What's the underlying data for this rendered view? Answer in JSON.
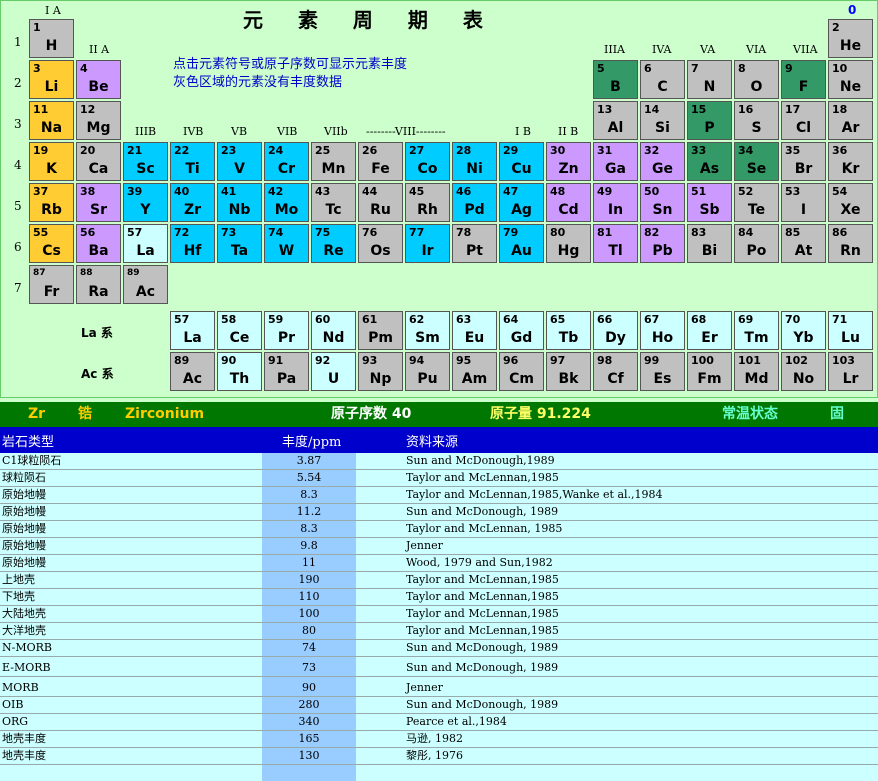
{
  "title": "元 素 周 期 表",
  "instructions": [
    "点击元素符号或原子序数可显示元素丰度",
    "灰色区域的元素没有丰度数据"
  ],
  "group_labels": [
    "I A",
    "II A",
    "IIIB",
    "IVB",
    "VB",
    "VIB",
    "VIIb",
    "--------VIII--------",
    "I B",
    "II B",
    "IIIA",
    "IVA",
    "VA",
    "VIA",
    "VIIA",
    "0"
  ],
  "period_labels": [
    "1",
    "2",
    "3",
    "4",
    "5",
    "6",
    "7"
  ],
  "series_labels": [
    "La 系",
    "Ac 系"
  ],
  "colors": {
    "alkali": "#ffcc33",
    "pblock_purple": "#cc99ff",
    "transition": "#00ccff",
    "green": "#339966",
    "gray": "#c0c0c0",
    "lanthanide": "#ccffff"
  },
  "elements": [
    {
      "n": "1",
      "s": "H",
      "r": 0,
      "c": 0,
      "t": "gray"
    },
    {
      "n": "2",
      "s": "He",
      "r": 0,
      "c": 17,
      "t": "gray"
    },
    {
      "n": "3",
      "s": "Li",
      "r": 1,
      "c": 0,
      "t": "alkali"
    },
    {
      "n": "4",
      "s": "Be",
      "r": 1,
      "c": 1,
      "t": "pblock_purple"
    },
    {
      "n": "5",
      "s": "B",
      "r": 1,
      "c": 12,
      "t": "green"
    },
    {
      "n": "6",
      "s": "C",
      "r": 1,
      "c": 13,
      "t": "gray"
    },
    {
      "n": "7",
      "s": "N",
      "r": 1,
      "c": 14,
      "t": "gray"
    },
    {
      "n": "8",
      "s": "O",
      "r": 1,
      "c": 15,
      "t": "gray"
    },
    {
      "n": "9",
      "s": "F",
      "r": 1,
      "c": 16,
      "t": "green"
    },
    {
      "n": "10",
      "s": "Ne",
      "r": 1,
      "c": 17,
      "t": "gray"
    },
    {
      "n": "11",
      "s": "Na",
      "r": 2,
      "c": 0,
      "t": "alkali"
    },
    {
      "n": "12",
      "s": "Mg",
      "r": 2,
      "c": 1,
      "t": "gray"
    },
    {
      "n": "13",
      "s": "Al",
      "r": 2,
      "c": 12,
      "t": "gray"
    },
    {
      "n": "14",
      "s": "Si",
      "r": 2,
      "c": 13,
      "t": "gray"
    },
    {
      "n": "15",
      "s": "P",
      "r": 2,
      "c": 14,
      "t": "green"
    },
    {
      "n": "16",
      "s": "S",
      "r": 2,
      "c": 15,
      "t": "gray"
    },
    {
      "n": "17",
      "s": "Cl",
      "r": 2,
      "c": 16,
      "t": "gray"
    },
    {
      "n": "18",
      "s": "Ar",
      "r": 2,
      "c": 17,
      "t": "gray"
    },
    {
      "n": "19",
      "s": "K",
      "r": 3,
      "c": 0,
      "t": "alkali"
    },
    {
      "n": "20",
      "s": "Ca",
      "r": 3,
      "c": 1,
      "t": "gray"
    },
    {
      "n": "21",
      "s": "Sc",
      "r": 3,
      "c": 2,
      "t": "transition"
    },
    {
      "n": "22",
      "s": "Ti",
      "r": 3,
      "c": 3,
      "t": "transition"
    },
    {
      "n": "23",
      "s": "V",
      "r": 3,
      "c": 4,
      "t": "transition"
    },
    {
      "n": "24",
      "s": "Cr",
      "r": 3,
      "c": 5,
      "t": "transition"
    },
    {
      "n": "25",
      "s": "Mn",
      "r": 3,
      "c": 6,
      "t": "gray"
    },
    {
      "n": "26",
      "s": "Fe",
      "r": 3,
      "c": 7,
      "t": "gray"
    },
    {
      "n": "27",
      "s": "Co",
      "r": 3,
      "c": 8,
      "t": "transition"
    },
    {
      "n": "28",
      "s": "Ni",
      "r": 3,
      "c": 9,
      "t": "transition"
    },
    {
      "n": "29",
      "s": "Cu",
      "r": 3,
      "c": 10,
      "t": "transition"
    },
    {
      "n": "30",
      "s": "Zn",
      "r": 3,
      "c": 11,
      "t": "pblock_purple"
    },
    {
      "n": "31",
      "s": "Ga",
      "r": 3,
      "c": 12,
      "t": "pblock_purple"
    },
    {
      "n": "32",
      "s": "Ge",
      "r": 3,
      "c": 13,
      "t": "pblock_purple"
    },
    {
      "n": "33",
      "s": "As",
      "r": 3,
      "c": 14,
      "t": "green"
    },
    {
      "n": "34",
      "s": "Se",
      "r": 3,
      "c": 15,
      "t": "green"
    },
    {
      "n": "35",
      "s": "Br",
      "r": 3,
      "c": 16,
      "t": "gray"
    },
    {
      "n": "36",
      "s": "Kr",
      "r": 3,
      "c": 17,
      "t": "gray"
    },
    {
      "n": "37",
      "s": "Rb",
      "r": 4,
      "c": 0,
      "t": "alkali"
    },
    {
      "n": "38",
      "s": "Sr",
      "r": 4,
      "c": 1,
      "t": "pblock_purple"
    },
    {
      "n": "39",
      "s": "Y",
      "r": 4,
      "c": 2,
      "t": "transition"
    },
    {
      "n": "40",
      "s": "Zr",
      "r": 4,
      "c": 3,
      "t": "transition"
    },
    {
      "n": "41",
      "s": "Nb",
      "r": 4,
      "c": 4,
      "t": "transition"
    },
    {
      "n": "42",
      "s": "Mo",
      "r": 4,
      "c": 5,
      "t": "transition"
    },
    {
      "n": "43",
      "s": "Tc",
      "r": 4,
      "c": 6,
      "t": "gray"
    },
    {
      "n": "44",
      "s": "Ru",
      "r": 4,
      "c": 7,
      "t": "gray"
    },
    {
      "n": "45",
      "s": "Rh",
      "r": 4,
      "c": 8,
      "t": "gray"
    },
    {
      "n": "46",
      "s": "Pd",
      "r": 4,
      "c": 9,
      "t": "transition"
    },
    {
      "n": "47",
      "s": "Ag",
      "r": 4,
      "c": 10,
      "t": "transition"
    },
    {
      "n": "48",
      "s": "Cd",
      "r": 4,
      "c": 11,
      "t": "pblock_purple"
    },
    {
      "n": "49",
      "s": "In",
      "r": 4,
      "c": 12,
      "t": "pblock_purple"
    },
    {
      "n": "50",
      "s": "Sn",
      "r": 4,
      "c": 13,
      "t": "pblock_purple"
    },
    {
      "n": "51",
      "s": "Sb",
      "r": 4,
      "c": 14,
      "t": "pblock_purple"
    },
    {
      "n": "52",
      "s": "Te",
      "r": 4,
      "c": 15,
      "t": "gray"
    },
    {
      "n": "53",
      "s": "I",
      "r": 4,
      "c": 16,
      "t": "gray"
    },
    {
      "n": "54",
      "s": "Xe",
      "r": 4,
      "c": 17,
      "t": "gray"
    },
    {
      "n": "55",
      "s": "Cs",
      "r": 5,
      "c": 0,
      "t": "alkali"
    },
    {
      "n": "56",
      "s": "Ba",
      "r": 5,
      "c": 1,
      "t": "pblock_purple"
    },
    {
      "n": "57",
      "s": "La",
      "r": 5,
      "c": 2,
      "t": "lanthanide"
    },
    {
      "n": "72",
      "s": "Hf",
      "r": 5,
      "c": 3,
      "t": "transition"
    },
    {
      "n": "73",
      "s": "Ta",
      "r": 5,
      "c": 4,
      "t": "transition"
    },
    {
      "n": "74",
      "s": "W",
      "r": 5,
      "c": 5,
      "t": "transition"
    },
    {
      "n": "75",
      "s": "Re",
      "r": 5,
      "c": 6,
      "t": "transition"
    },
    {
      "n": "76",
      "s": "Os",
      "r": 5,
      "c": 7,
      "t": "gray"
    },
    {
      "n": "77",
      "s": "Ir",
      "r": 5,
      "c": 8,
      "t": "transition"
    },
    {
      "n": "78",
      "s": "Pt",
      "r": 5,
      "c": 9,
      "t": "gray"
    },
    {
      "n": "79",
      "s": "Au",
      "r": 5,
      "c": 10,
      "t": "transition"
    },
    {
      "n": "80",
      "s": "Hg",
      "r": 5,
      "c": 11,
      "t": "gray"
    },
    {
      "n": "81",
      "s": "Tl",
      "r": 5,
      "c": 12,
      "t": "pblock_purple"
    },
    {
      "n": "82",
      "s": "Pb",
      "r": 5,
      "c": 13,
      "t": "pblock_purple"
    },
    {
      "n": "83",
      "s": "Bi",
      "r": 5,
      "c": 14,
      "t": "gray"
    },
    {
      "n": "84",
      "s": "Po",
      "r": 5,
      "c": 15,
      "t": "gray"
    },
    {
      "n": "85",
      "s": "At",
      "r": 5,
      "c": 16,
      "t": "gray"
    },
    {
      "n": "86",
      "s": "Rn",
      "r": 5,
      "c": 17,
      "t": "gray"
    },
    {
      "n": "87",
      "s": "Fr",
      "r": 6,
      "c": 0,
      "t": "gray"
    },
    {
      "n": "88",
      "s": "Ra",
      "r": 6,
      "c": 1,
      "t": "gray"
    },
    {
      "n": "89",
      "s": "Ac",
      "r": 6,
      "c": 2,
      "t": "gray"
    },
    {
      "n": "57",
      "s": "La",
      "r": 7,
      "c": 3,
      "t": "lanthanide"
    },
    {
      "n": "58",
      "s": "Ce",
      "r": 7,
      "c": 4,
      "t": "lanthanide"
    },
    {
      "n": "59",
      "s": "Pr",
      "r": 7,
      "c": 5,
      "t": "lanthanide"
    },
    {
      "n": "60",
      "s": "Nd",
      "r": 7,
      "c": 6,
      "t": "lanthanide"
    },
    {
      "n": "61",
      "s": "Pm",
      "r": 7,
      "c": 7,
      "t": "gray"
    },
    {
      "n": "62",
      "s": "Sm",
      "r": 7,
      "c": 8,
      "t": "lanthanide"
    },
    {
      "n": "63",
      "s": "Eu",
      "r": 7,
      "c": 9,
      "t": "lanthanide"
    },
    {
      "n": "64",
      "s": "Gd",
      "r": 7,
      "c": 10,
      "t": "lanthanide"
    },
    {
      "n": "65",
      "s": "Tb",
      "r": 7,
      "c": 11,
      "t": "lanthanide"
    },
    {
      "n": "66",
      "s": "Dy",
      "r": 7,
      "c": 12,
      "t": "lanthanide"
    },
    {
      "n": "67",
      "s": "Ho",
      "r": 7,
      "c": 13,
      "t": "lanthanide"
    },
    {
      "n": "68",
      "s": "Er",
      "r": 7,
      "c": 14,
      "t": "lanthanide"
    },
    {
      "n": "69",
      "s": "Tm",
      "r": 7,
      "c": 15,
      "t": "lanthanide"
    },
    {
      "n": "70",
      "s": "Yb",
      "r": 7,
      "c": 16,
      "t": "lanthanide"
    },
    {
      "n": "71",
      "s": "Lu",
      "r": 7,
      "c": 17,
      "t": "lanthanide"
    },
    {
      "n": "89",
      "s": "Ac",
      "r": 8,
      "c": 3,
      "t": "gray"
    },
    {
      "n": "90",
      "s": "Th",
      "r": 8,
      "c": 4,
      "t": "lanthanide"
    },
    {
      "n": "91",
      "s": "Pa",
      "r": 8,
      "c": 5,
      "t": "gray"
    },
    {
      "n": "92",
      "s": "U",
      "r": 8,
      "c": 6,
      "t": "lanthanide"
    },
    {
      "n": "93",
      "s": "Np",
      "r": 8,
      "c": 7,
      "t": "gray"
    },
    {
      "n": "94",
      "s": "Pu",
      "r": 8,
      "c": 8,
      "t": "gray"
    },
    {
      "n": "95",
      "s": "Am",
      "r": 8,
      "c": 9,
      "t": "gray"
    },
    {
      "n": "96",
      "s": "Cm",
      "r": 8,
      "c": 10,
      "t": "gray"
    },
    {
      "n": "97",
      "s": "Bk",
      "r": 8,
      "c": 11,
      "t": "gray"
    },
    {
      "n": "98",
      "s": "Cf",
      "r": 8,
      "c": 12,
      "t": "gray"
    },
    {
      "n": "99",
      "s": "Es",
      "r": 8,
      "c": 13,
      "t": "gray"
    },
    {
      "n": "100",
      "s": "Fm",
      "r": 8,
      "c": 14,
      "t": "gray"
    },
    {
      "n": "101",
      "s": "Md",
      "r": 8,
      "c": 15,
      "t": "gray"
    },
    {
      "n": "102",
      "s": "No",
      "r": 8,
      "c": 16,
      "t": "gray"
    },
    {
      "n": "103",
      "s": "Lr",
      "r": 8,
      "c": 17,
      "t": "gray"
    }
  ],
  "selected": {
    "symbol": "Zr",
    "name_cn": "锆",
    "name_en": "Zirconium",
    "atomic_number_label": "原子序数 40",
    "atomic_mass_label": "原子量 91.224",
    "state_label": "常温状态",
    "state_value": "固"
  },
  "table": {
    "headers": [
      "岩石类型",
      "丰度/ppm",
      "资料来源"
    ],
    "rows": [
      [
        "C1球粒陨石",
        "3.87",
        "Sun and McDonough,1989"
      ],
      [
        "球粒陨石",
        "5.54",
        "Taylor and McLennan,1985"
      ],
      [
        "原始地幔",
        "8.3",
        "Taylor and McLennan,1985,Wanke et al.,1984"
      ],
      [
        "原始地幔",
        "11.2",
        "Sun and McDonough, 1989"
      ],
      [
        "原始地幔",
        "8.3",
        "Taylor and McLennan, 1985"
      ],
      [
        "原始地幔",
        "9.8",
        "Jenner"
      ],
      [
        "原始地幔",
        "11",
        "Wood, 1979 and Sun,1982"
      ],
      [
        "上地壳",
        "190",
        "Taylor and McLennan,1985"
      ],
      [
        "下地壳",
        "110",
        "Taylor and McLennan,1985"
      ],
      [
        "大陆地壳",
        "100",
        "Taylor and McLennan,1985"
      ],
      [
        "大洋地壳",
        "80",
        "Taylor and McLennan,1985"
      ],
      [
        "N-MORB",
        "74",
        "Sun and McDonough, 1989"
      ],
      [
        "E-MORB",
        "73",
        "Sun and McDonough, 1989"
      ],
      [
        "MORB",
        "90",
        "Jenner"
      ],
      [
        "OIB",
        "280",
        "Sun and McDonough, 1989"
      ],
      [
        "ORG",
        "340",
        "Pearce et al.,1984"
      ],
      [
        "地壳丰度",
        "165",
        "马逊, 1982"
      ],
      [
        "地壳丰度",
        "130",
        "黎彤, 1976"
      ]
    ]
  }
}
